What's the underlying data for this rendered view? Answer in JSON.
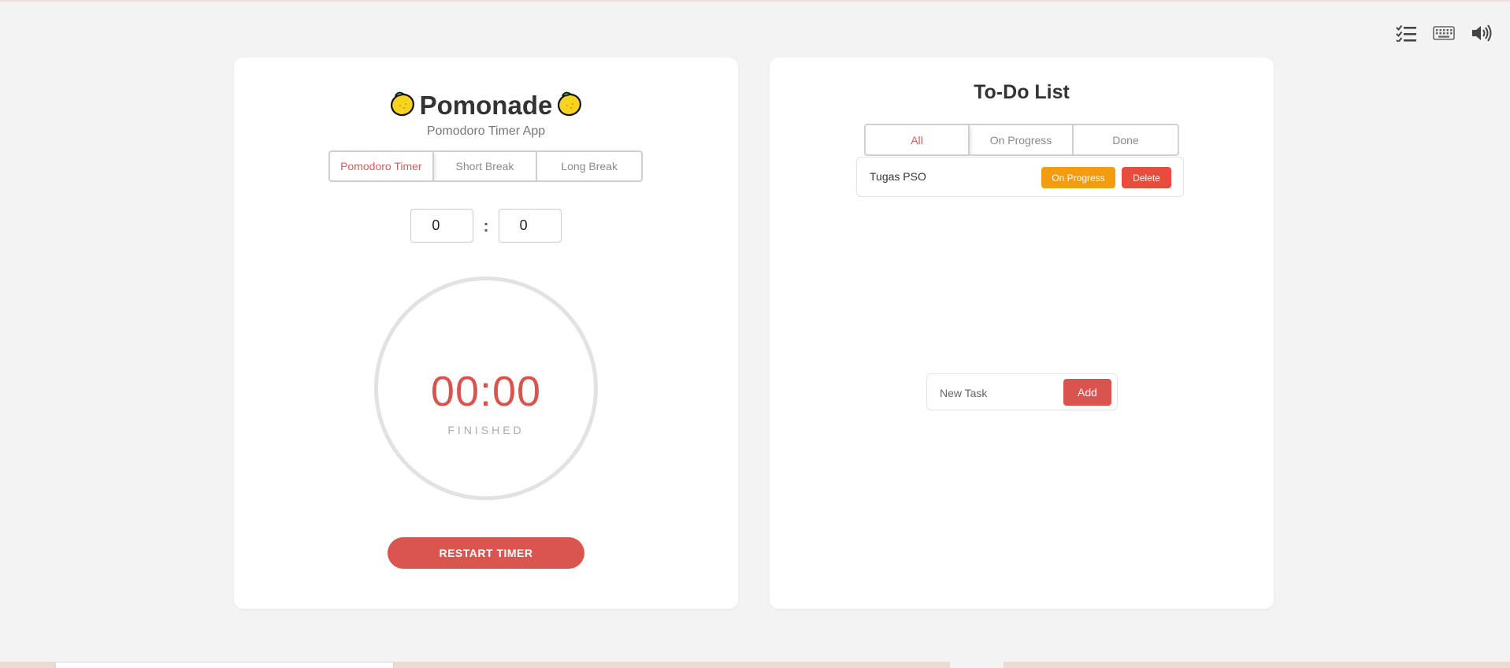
{
  "toolbar": {
    "icons": [
      "task-list-icon",
      "keyboard-icon",
      "volume-icon"
    ]
  },
  "timer": {
    "app_name": "Pomonade",
    "subtitle": "Pomodoro Timer App",
    "modes": [
      "Pomodoro Timer",
      "Short Break",
      "Long Break"
    ],
    "active_mode": "Pomodoro Timer",
    "minutes_value": "0",
    "seconds_value": "0",
    "colon": ":",
    "display_time": "00:00",
    "status": "FINISHED",
    "restart_label": "RESTART TIMER",
    "accent_color": "#d9534f"
  },
  "todo": {
    "title": "To-Do List",
    "filters": [
      "All",
      "On Progress",
      "Done"
    ],
    "active_filter": "All",
    "tasks": [
      {
        "name": "Tugas PSO",
        "status_label": "On Progress",
        "delete_label": "Delete"
      }
    ],
    "new_task_placeholder": "New Task",
    "add_label": "Add",
    "progress_color": "#f39c12",
    "delete_color": "#e74c3c"
  }
}
